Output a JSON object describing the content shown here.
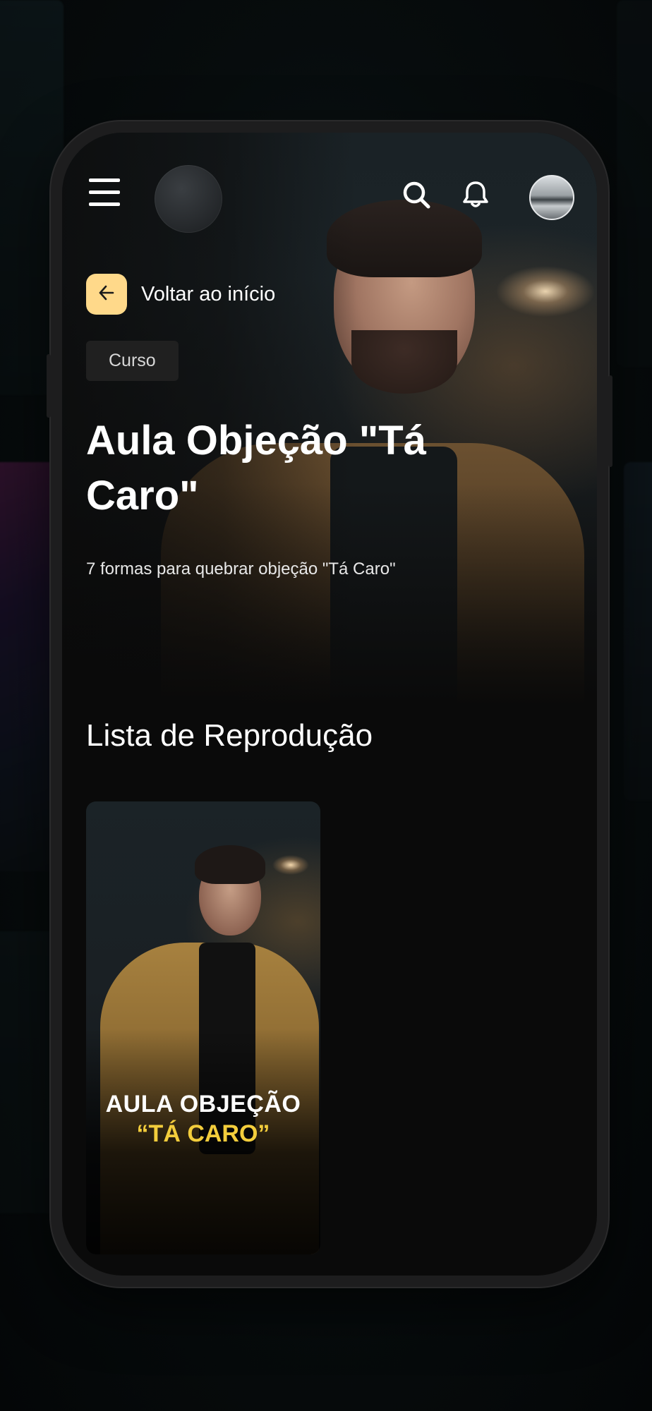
{
  "header": {
    "menu_icon": "menu-icon",
    "search_icon": "search-icon",
    "notification_icon": "bell-icon"
  },
  "back": {
    "label": "Voltar ao início",
    "icon": "arrow-left-icon",
    "color": "#FFD98A"
  },
  "hero": {
    "badge": "Curso",
    "title": "Aula Objeção \"Tá Caro\"",
    "subtitle": "7 formas para quebrar objeção \"Tá Caro\""
  },
  "playlist": {
    "section_title": "Lista de Reprodução",
    "items": [
      {
        "title_line1": "AULA OBJEÇÃO",
        "title_line2": "“TÁ CARO”",
        "accent": "#F3CD3C"
      }
    ]
  }
}
